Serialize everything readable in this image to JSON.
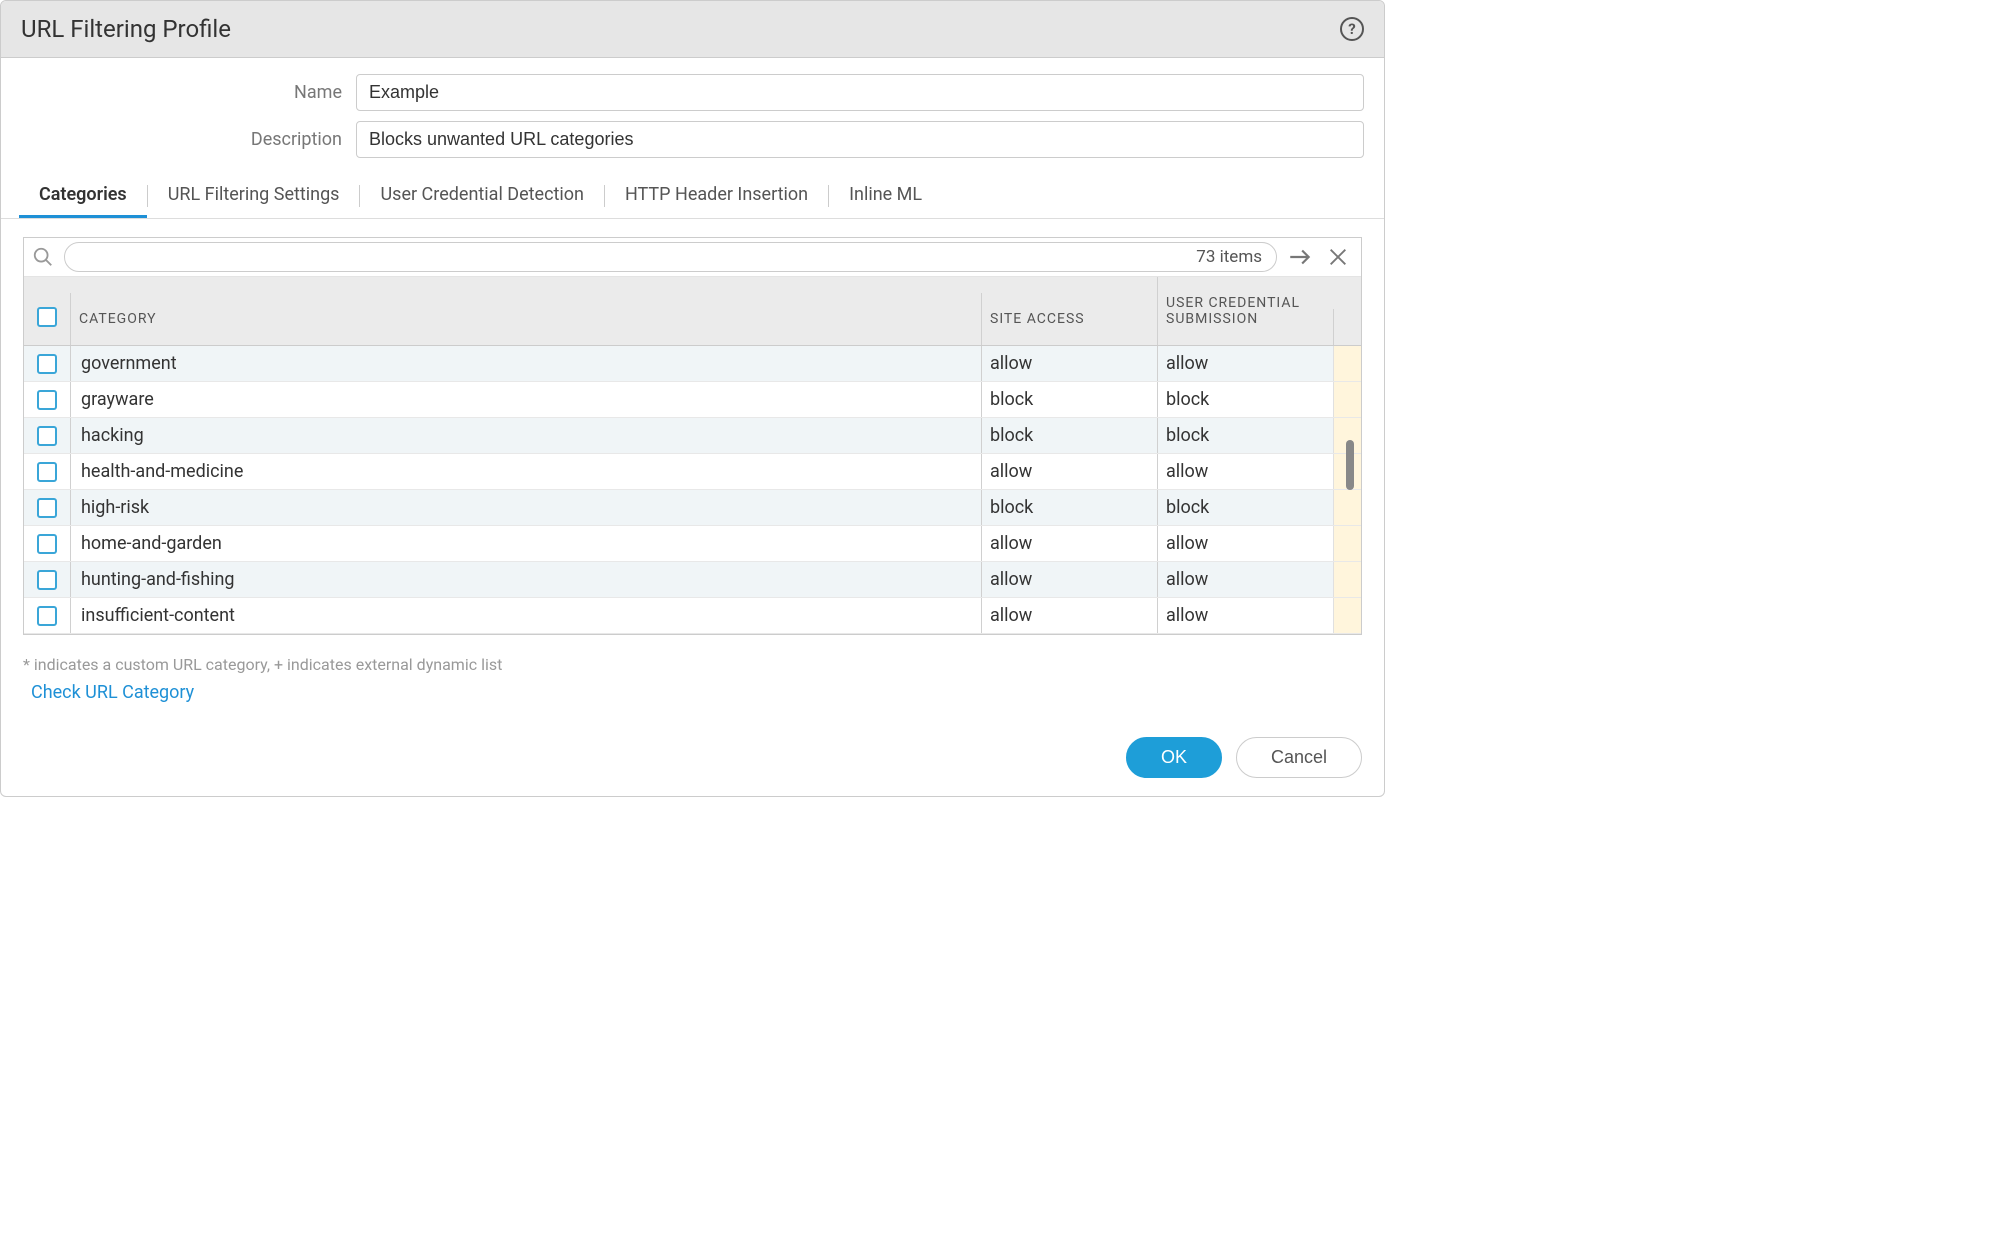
{
  "dialog": {
    "title": "URL Filtering Profile"
  },
  "form": {
    "name_label": "Name",
    "name_value": "Example",
    "description_label": "Description",
    "description_value": "Blocks unwanted URL categories"
  },
  "tabs": [
    {
      "label": "Categories",
      "active": true
    },
    {
      "label": "URL Filtering Settings",
      "active": false
    },
    {
      "label": "User Credential Detection",
      "active": false
    },
    {
      "label": "HTTP Header Insertion",
      "active": false
    },
    {
      "label": "Inline ML",
      "active": false
    }
  ],
  "grid": {
    "item_count_text": "73 items",
    "columns": {
      "category": "CATEGORY",
      "site_access": "SITE ACCESS",
      "user_credential": "USER CREDENTIAL SUBMISSION"
    },
    "rows": [
      {
        "category": "government",
        "site_access": "allow",
        "credential": "allow"
      },
      {
        "category": "grayware",
        "site_access": "block",
        "credential": "block"
      },
      {
        "category": "hacking",
        "site_access": "block",
        "credential": "block"
      },
      {
        "category": "health-and-medicine",
        "site_access": "allow",
        "credential": "allow"
      },
      {
        "category": "high-risk",
        "site_access": "block",
        "credential": "block"
      },
      {
        "category": "home-and-garden",
        "site_access": "allow",
        "credential": "allow"
      },
      {
        "category": "hunting-and-fishing",
        "site_access": "allow",
        "credential": "allow"
      },
      {
        "category": "insufficient-content",
        "site_access": "allow",
        "credential": "allow"
      }
    ]
  },
  "footer": {
    "note": "* indicates a custom URL category, + indicates external dynamic list",
    "link": "Check URL Category"
  },
  "actions": {
    "ok": "OK",
    "cancel": "Cancel"
  }
}
